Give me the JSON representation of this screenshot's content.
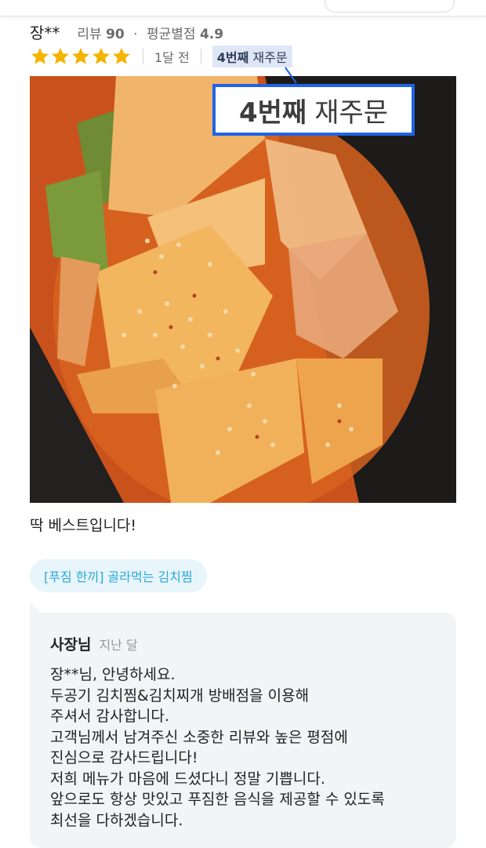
{
  "reviewer": {
    "name": "장**",
    "review_count_label": "리뷰",
    "review_count": "90",
    "avg_rating_label": "평균별점",
    "avg_rating": "4.9"
  },
  "rating": {
    "stars": 5,
    "max_stars": 5,
    "star_color": "#f5b400",
    "time_ago": "1달 전",
    "reorder_number": "4번째",
    "reorder_word": "재주문"
  },
  "photo": {
    "callout_number": "4번째",
    "callout_word": "재주문",
    "callout_border_color": "#1f63e6"
  },
  "review_text": "딱 베스트입니다!",
  "menu_chip": "[푸짐 한끼] 골라먹는 김치찜",
  "reply": {
    "author": "사장님",
    "date": "지난 달",
    "lines": [
      "장**님, 안녕하세요.",
      "두공기 김치찜&김치찌개 방배점을 이용해",
      "주셔서 감사합니다.",
      "고객님께서 남겨주신 소중한 리뷰와 높은 평점에",
      "진심으로 감사드립니다!",
      "저희 메뉴가 마음에 드셨다니 정말 기쁩니다.",
      "앞으로도 항상 맛있고 푸짐한 음식을 제공할 수 있도록",
      "최선을 다하겠습니다."
    ]
  }
}
